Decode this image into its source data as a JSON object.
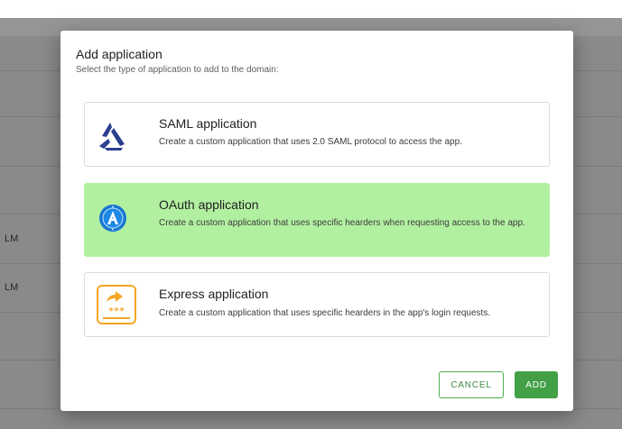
{
  "background": {
    "realm_labels": [
      "LM",
      "LM"
    ]
  },
  "dialog": {
    "title": "Add application",
    "subtitle": "Select the type of application to add to the domain:",
    "options": [
      {
        "title": "SAML application",
        "description": "Create a custom application that uses 2.0 SAML protocol to access the app.",
        "icon": "saml-logo-icon",
        "selected": false
      },
      {
        "title": "OAuth application",
        "description": "Create a custom application that uses specific hearders when requesting access to the app.",
        "icon": "oauth-logo-icon",
        "selected": true
      },
      {
        "title": "Express application",
        "description": "Create a custom application that uses specific hearders in the app's login requests.",
        "icon": "express-logo-icon",
        "selected": false
      }
    ],
    "buttons": {
      "cancel": "CANCEL",
      "add": "ADD"
    }
  },
  "colors": {
    "selected_card": "#b2f0a1",
    "accent_green": "#43a047",
    "saml_blue": "#2b3f8f",
    "oauth_blue": "#1976d2",
    "express_orange": "#f5a623"
  }
}
